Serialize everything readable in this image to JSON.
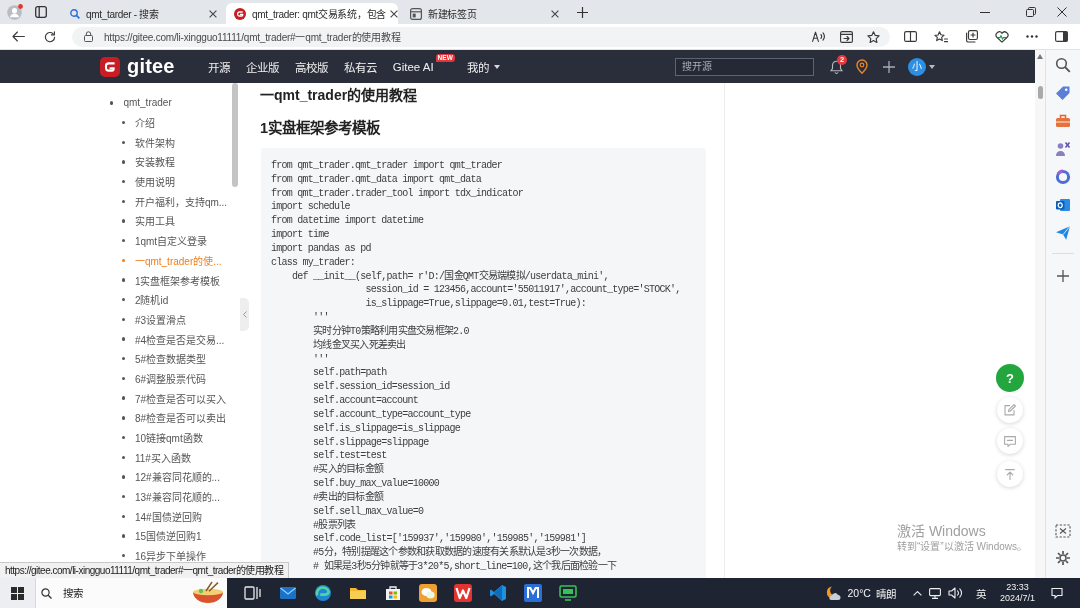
{
  "browser": {
    "tabs": [
      {
        "kind": "search",
        "title": "qmt_tarder - 搜索",
        "selected": false
      },
      {
        "kind": "site",
        "title": "qmt_trader: qmt交易系统，包含",
        "selected": true
      },
      {
        "kind": "newtab",
        "title": "新建标签页",
        "selected": false
      }
    ],
    "address_bar": {
      "url": "https://gitee.com/li-xingguo11111/qmt_trader#一qmt_trader的使用教程"
    }
  },
  "site_header": {
    "logo_text": "gitee",
    "nav": [
      {
        "kind": "link",
        "label": "开源"
      },
      {
        "kind": "link",
        "label": "企业版"
      },
      {
        "kind": "link",
        "label": "高校版"
      },
      {
        "kind": "link",
        "label": "私有云"
      },
      {
        "kind": "badge",
        "label": "Gitee AI",
        "badge": "NEW"
      },
      {
        "kind": "menu",
        "label": "我的"
      }
    ],
    "search": {
      "placeholder": "搜开源"
    },
    "notification_count": "2",
    "avatar_initial": "小"
  },
  "toc": {
    "items": [
      {
        "label": "qmt_trader",
        "selected": false,
        "children": [
          {
            "label": "介绍",
            "selected": false
          },
          {
            "label": "软件架构",
            "selected": false
          },
          {
            "label": "安装教程",
            "selected": false
          },
          {
            "label": "使用说明",
            "selected": false
          },
          {
            "label": "开户福利，支持qm...",
            "selected": false
          },
          {
            "label": "实用工具",
            "selected": false
          },
          {
            "label": "1qmt自定义登录",
            "selected": false
          },
          {
            "label": "一qmt_trader的使...",
            "selected": true
          },
          {
            "label": "1实盘框架参考模板",
            "selected": false
          },
          {
            "label": "2随机id",
            "selected": false
          },
          {
            "label": "#3设置滑点",
            "selected": false
          },
          {
            "label": "#4检查是否是交易...",
            "selected": false
          },
          {
            "label": "5#检查数据类型",
            "selected": false
          },
          {
            "label": "6#调整股票代码",
            "selected": false
          },
          {
            "label": "7#检查是否可以买入",
            "selected": false
          },
          {
            "label": "8#检查是否可以卖出",
            "selected": false
          },
          {
            "label": "10链接qmt函数",
            "selected": false
          },
          {
            "label": "11#买入函数",
            "selected": false
          },
          {
            "label": "12#兼容同花顺的...",
            "selected": false
          },
          {
            "label": "13#兼容同花顺的...",
            "selected": false
          },
          {
            "label": "14#国债逆回购",
            "selected": false
          },
          {
            "label": "15国债逆回购1",
            "selected": false
          },
          {
            "label": "16异步下单操作",
            "selected": false
          }
        ]
      }
    ]
  },
  "article": {
    "title": "一qmt_trader的使用教程",
    "section_title": "1实盘框架参考模板",
    "code_lines": [
      "from qmt_trader.qmt_trader import qmt_trader",
      "from qmt_trader.qmt_data import qmt_data",
      "from qmt_trader.trader_tool import tdx_indicator",
      "import schedule",
      "from datetime import datetime",
      "import time",
      "import pandas as pd",
      "class my_trader:",
      "    def __init__(self,path= r'D:/国金QMT交易端模拟/userdata_mini',",
      "                  session_id = 123456,account='55011917',account_type='STOCK',",
      "                  is_slippage=True,slippage=0.01,test=True):",
      "        '''",
      "        实时分钟T0策略利用实盘交易框架2.0",
      "        均线金叉买入死差卖出",
      "        '''",
      "        self.path=path",
      "        self.session_id=session_id",
      "        self.account=account",
      "        self.account_type=account_type",
      "        self.is_slippage=is_slippage",
      "        self.slippage=slippage",
      "        self.test=test",
      "        #买入的目标金额",
      "        self.buy_max_value=10000",
      "        #卖出的目标金额",
      "        self.sell_max_value=0",
      "        #股票列表",
      "        self.code_list=['159937','159980','159985','159981']",
      "        #5分，特别提醒这个参数和获取数据的速度有关系默认是3秒一次数据，",
      "        # 如果是3秒5分钟就等于3*20*5,short_line=100,这个我后面检验一下"
    ]
  },
  "floating_actions": {
    "help_label": "?"
  },
  "status_url": "https://gitee.com/li-xingguo11111/qmt_trader#一qmt_trader的使用教程",
  "activation_notice": {
    "title": "激活 Windows",
    "hint": "转到“设置”以激活 Windows。"
  },
  "taskbar": {
    "search": {
      "placeholder": "搜索"
    },
    "weather": {
      "temperature": "20°C",
      "condition": "晴朗"
    },
    "input_indicator": "英",
    "time": "23:33",
    "date": "2024/7/1"
  }
}
